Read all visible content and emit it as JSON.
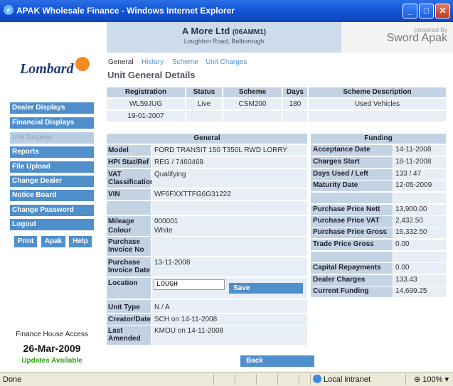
{
  "window": {
    "title": "APAK Wholesale Finance - Windows Internet Explorer",
    "min_glyph": "_",
    "max_glyph": "□",
    "close_glyph": "✕",
    "ie_glyph": "e"
  },
  "header": {
    "company_name": "A More Ltd",
    "company_code": "(06AMM1)",
    "address": "Loughton Road, Belborough",
    "powered_by": "powered by",
    "brand": "Sword Apak"
  },
  "logo": {
    "text": "Lombard"
  },
  "sidebar": {
    "items": [
      {
        "label": "Dealer Displays",
        "active": true
      },
      {
        "label": "Financial Displays",
        "active": true
      },
      {
        "label": "Unit Displays",
        "active": false
      },
      {
        "label": "Reports",
        "active": true
      },
      {
        "label": "File Upload",
        "active": true
      },
      {
        "label": "Change Dealer",
        "active": true
      },
      {
        "label": "Notice Board",
        "active": true
      },
      {
        "label": "Change Password",
        "active": true
      },
      {
        "label": "Logout",
        "active": true
      }
    ],
    "print_label": "Print",
    "apak_label": "Apak",
    "help_label": "Help",
    "finance_house_access": "Finance House Access",
    "date": "26-Mar-2009",
    "updates": "Updates Available"
  },
  "tabs": [
    {
      "label": "General",
      "active": true
    },
    {
      "label": "History",
      "active": false
    },
    {
      "label": "Scheme",
      "active": false
    },
    {
      "label": "Unit Charges",
      "active": false
    }
  ],
  "section_title": "Unit General Details",
  "summary": {
    "headers": [
      "Registration",
      "Status",
      "Scheme",
      "Days",
      "Scheme Description"
    ],
    "row1": [
      "WL59JUG",
      "Live",
      "CSM200",
      "180",
      "Used Vehicles"
    ],
    "row2": [
      "19-01-2007",
      "",
      "",
      "",
      ""
    ]
  },
  "general": {
    "heading": "General",
    "rows": [
      {
        "label": "Model",
        "value": "FORD TRANSIT 150 T350L RWD LORRY"
      },
      {
        "label": "HPI Stat/Ref",
        "value": "REG / 7460469"
      },
      {
        "label": "VAT Classification",
        "value": "Qualifying"
      },
      {
        "label": "VIN",
        "value": "WF6FXXTTFG6G31222"
      },
      {
        "label": "",
        "value": ""
      },
      {
        "label": "Mileage",
        "value": "000001"
      },
      {
        "label": "Colour",
        "value": "White"
      },
      {
        "label": "Purchase Invoice No",
        "value": ""
      },
      {
        "label": "Purchase Invoice Date",
        "value": "13-11-2008"
      },
      {
        "label": "Location",
        "value": ""
      },
      {
        "label": "",
        "value": ""
      },
      {
        "label": "Unit Type",
        "value": "N / A"
      },
      {
        "label": "Creator/Date",
        "value": "SCH on 14-11-2008"
      },
      {
        "label": "Last Amended",
        "value": "KMOU on 14-11-2008"
      }
    ],
    "location_value": "LOUGH",
    "save_label": "Save"
  },
  "funding": {
    "heading": "Funding",
    "rows": [
      {
        "label": "Acceptance Date",
        "value": "14-11-2008"
      },
      {
        "label": "Charges Start",
        "value": "18-11-2008"
      },
      {
        "label": "Days Used / Left",
        "value": "133 / 47"
      },
      {
        "label": "Maturity Date",
        "value": "12-05-2009"
      },
      {
        "label": "",
        "value": ""
      },
      {
        "label": "Purchase Price Nett",
        "value": "13,900.00"
      },
      {
        "label": "Purchase Price VAT",
        "value": "2,432.50"
      },
      {
        "label": "Purchase Price Gross",
        "value": "16,332.50"
      },
      {
        "label": "Trade Price Gross",
        "value": "0.00"
      },
      {
        "label": "",
        "value": ""
      },
      {
        "label": "Capital Repayments",
        "value": "0.00"
      },
      {
        "label": "Dealer Charges",
        "value": "133.43"
      },
      {
        "label": "Current Funding",
        "value": "14,699.25"
      }
    ]
  },
  "back_label": "Back",
  "statusbar": {
    "status": "Done",
    "zone": "Local intranet",
    "zoom": "100%"
  }
}
